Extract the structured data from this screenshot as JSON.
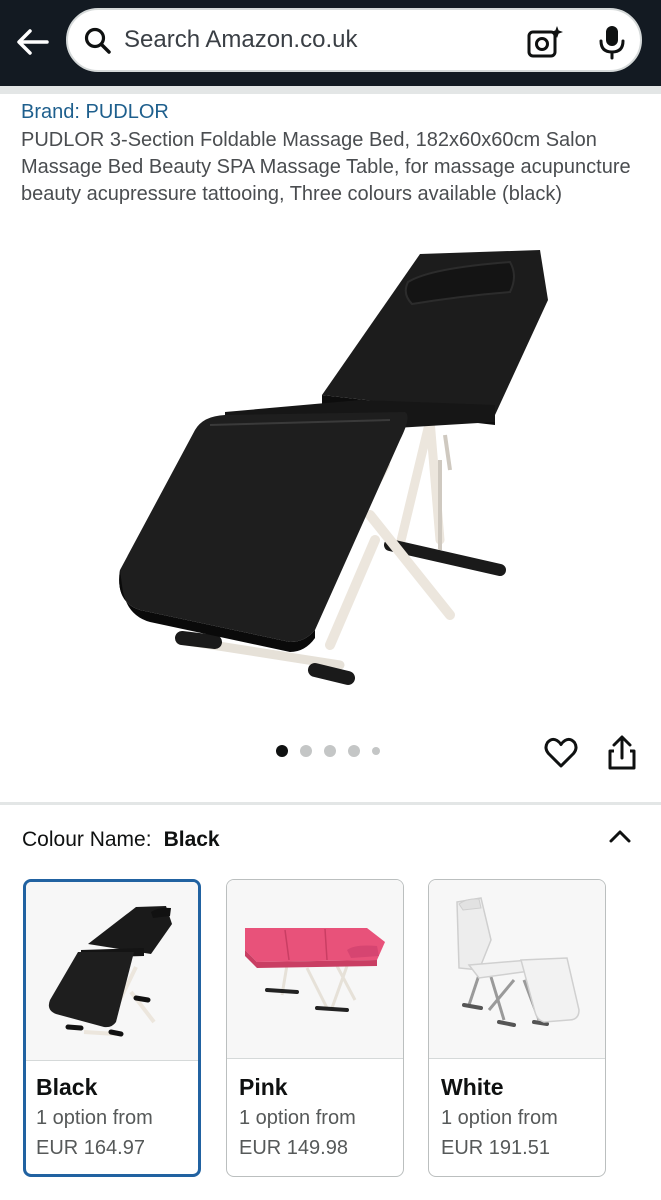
{
  "search": {
    "placeholder": "Search Amazon.co.uk"
  },
  "product": {
    "brand_link": "Brand: PUDLOR",
    "title": "PUDLOR 3-Section Foldable Massage Bed, 182x60x60cm Salon Massage Bed Beauty SPA Massage Table, for massage acupuncture beauty acupressure tattooing, Three colours available (black)"
  },
  "gallery": {
    "dots": 5,
    "active_dot": 1
  },
  "colour": {
    "label": "Colour Name:",
    "selected": "Black",
    "options": [
      {
        "name": "Black",
        "availability": "1 option from",
        "price": "EUR 164.97",
        "color": "#1a1a1a"
      },
      {
        "name": "Pink",
        "availability": "1 option from",
        "price": "EUR 149.98",
        "color": "#e8527a"
      },
      {
        "name": "White",
        "availability": "1 option from",
        "price": "EUR 191.51",
        "color": "#ececec"
      }
    ]
  },
  "colors": {
    "header_bg": "#131a22",
    "brand_link": "#1e5f8d",
    "selected_border": "#2162a1"
  }
}
